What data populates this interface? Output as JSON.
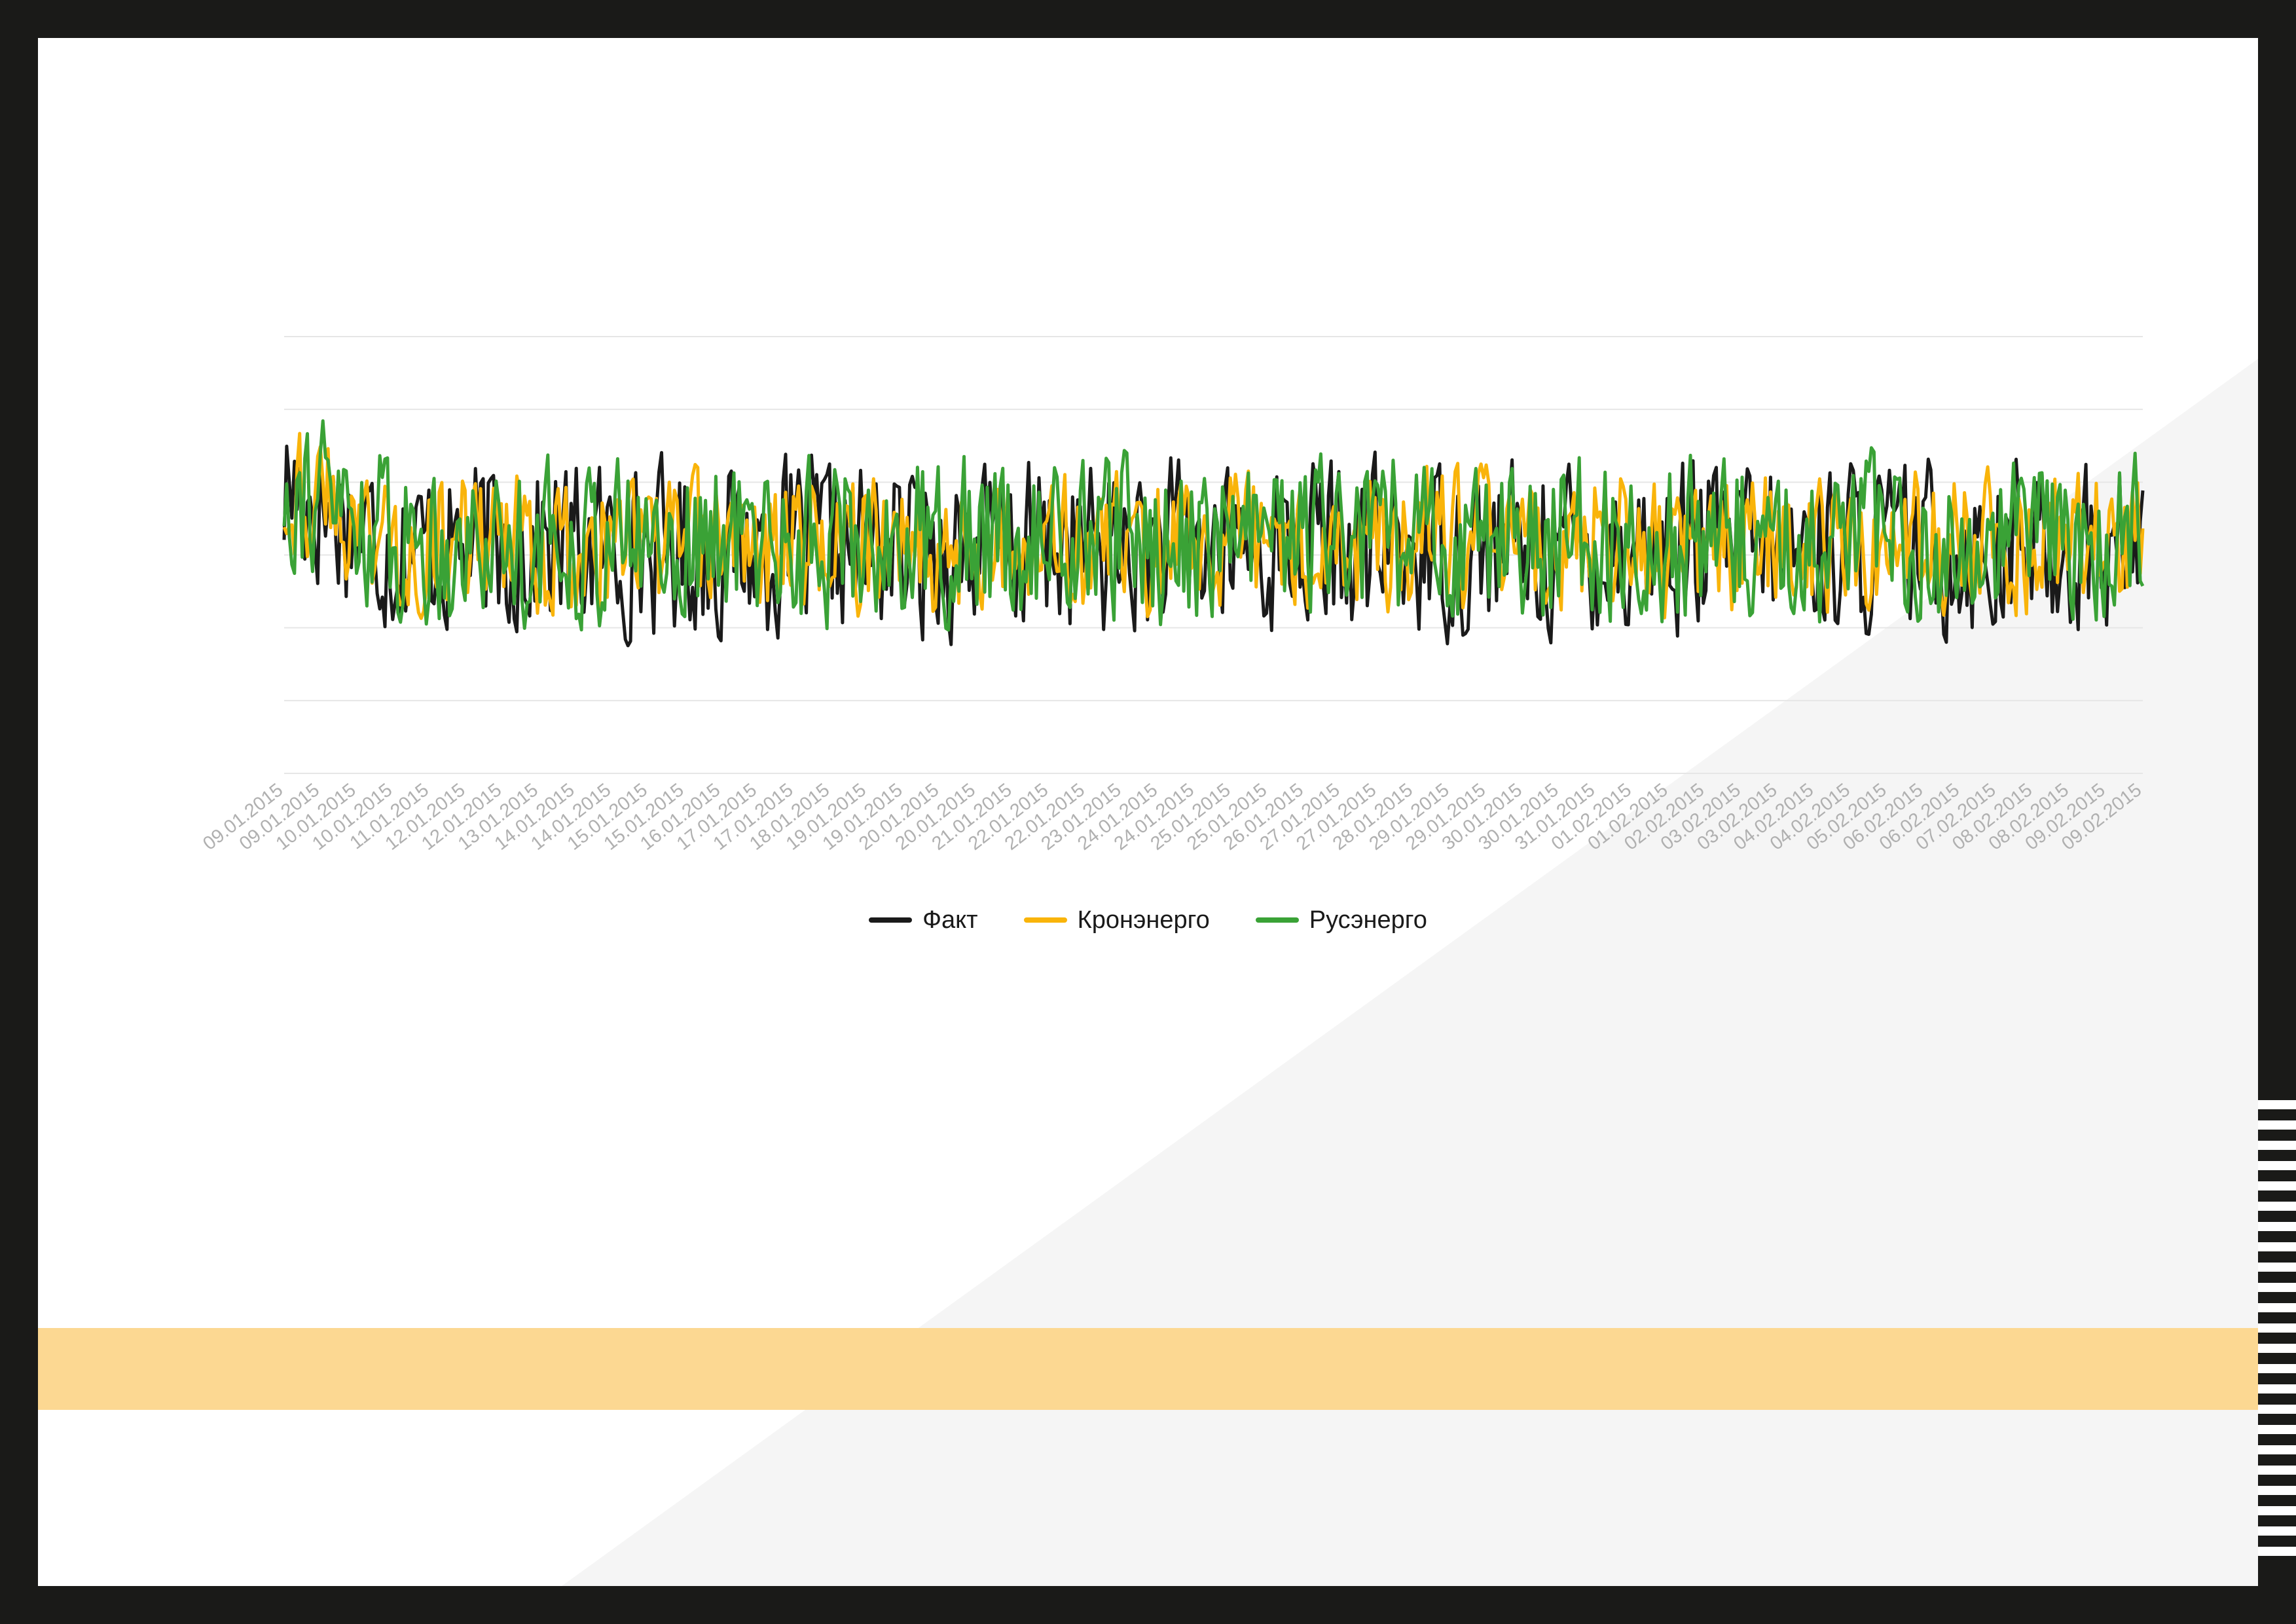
{
  "colors": {
    "frame": "#1a1a18",
    "page": "#ffffff",
    "triangle": "#f5f5f5",
    "band": "#fcd892",
    "grid": "#e6e6e6",
    "tick_label": "#b0b0b0"
  },
  "chart_data": {
    "type": "line",
    "title": "",
    "xlabel": "",
    "ylabel": "",
    "ylim": [
      0,
      6
    ],
    "grid": true,
    "y_gridlines": 6,
    "legend_position": "bottom-center",
    "x_tick_labels": [
      "09.01.2015",
      "09.01.2015",
      "10.01.2015",
      "10.01.2015",
      "11.01.2015",
      "12.01.2015",
      "12.01.2015",
      "13.01.2015",
      "14.01.2015",
      "14.01.2015",
      "15.01.2015",
      "15.01.2015",
      "16.01.2015",
      "17.01.2015",
      "17.01.2015",
      "18.01.2015",
      "19.01.2015",
      "19.01.2015",
      "20.01.2015",
      "20.01.2015",
      "21.01.2015",
      "22.01.2015",
      "22.01.2015",
      "23.01.2015",
      "24.01.2015",
      "24.01.2015",
      "25.01.2015",
      "25.01.2015",
      "26.01.2015",
      "27.01.2015",
      "27.01.2015",
      "28.01.2015",
      "29.01.2015",
      "29.01.2015",
      "30.01.2015",
      "30.01.2015",
      "31.01.2015",
      "01.02.2015",
      "01.02.2015",
      "02.02.2015",
      "03.02.2015",
      "03.02.2015",
      "04.02.2015",
      "04.02.2015",
      "05.02.2015",
      "06.02.2015",
      "06.02.2015",
      "07.02.2015",
      "08.02.2015",
      "08.02.2015",
      "09.02.2015",
      "09.02.2015"
    ],
    "points_per_series": 720,
    "series": [
      {
        "name": "Факт",
        "color": "#1a1a1a",
        "seed": 17,
        "mean": 3.1,
        "amp": 1.05
      },
      {
        "name": "Кронэнерго",
        "color": "#f9b40a",
        "seed": 43,
        "mean": 3.15,
        "amp": 0.85
      },
      {
        "name": "Русэнерго",
        "color": "#3aa236",
        "seed": 91,
        "mean": 3.2,
        "amp": 1.0
      }
    ]
  }
}
